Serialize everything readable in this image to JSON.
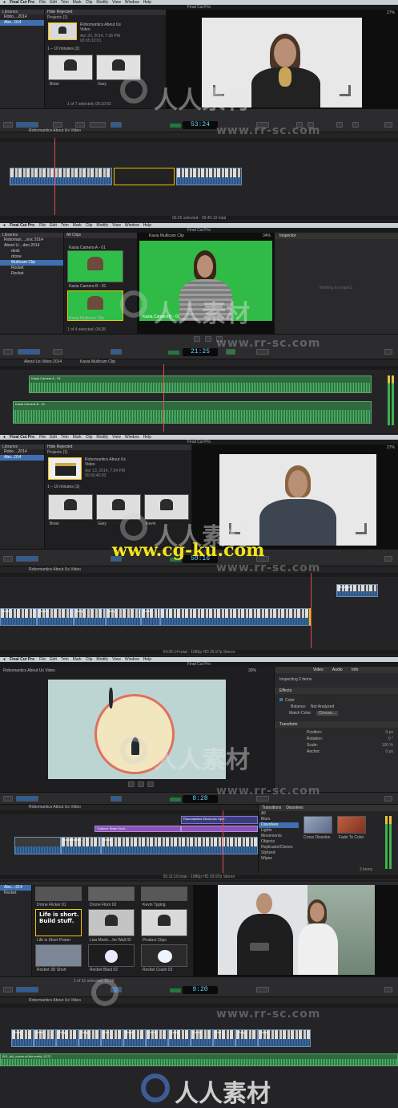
{
  "menu": {
    "app": "Final Cut Pro",
    "items": [
      "File",
      "Edit",
      "Trim",
      "Mark",
      "Clip",
      "Modify",
      "View",
      "Window",
      "Help"
    ]
  },
  "window_title": "Final Cut Pro",
  "panel1": {
    "libraries_label": "Libraries",
    "lib_items": [
      "Robo....2014",
      "Abo...014"
    ],
    "browser_filter": "Hide Rejected",
    "projects_section": "Projects",
    "projects_count": "(1)",
    "project_title": "Robomantics About Us Video",
    "project_date": "Apr 20, 2014, 7:36 PM",
    "project_duration": "00:05:10:01",
    "range_section": "1 – 10 minutes",
    "range_count": "(2)",
    "clip_names": [
      "Brian",
      "Gary"
    ],
    "selection_status": "1 of 7 selected, 05:10:01",
    "zoom": "27%",
    "timecode": "53:24",
    "timeline_title": "Robomantics About Us Video",
    "status": "00:25 selected - 05:40:10 total"
  },
  "panel2": {
    "libraries_label": "Libraries",
    "lib_items": [
      "Roboman....onic 2014",
      "About U....deo 2014",
      "desk",
      "drone",
      "Multicam Clip",
      "Rocket",
      "Rocket"
    ],
    "browser_filter": "All Clips",
    "clip_names": [
      "Kasia Camera A - 01",
      "Kasia Camera B - 01",
      "Kasia Multicam Clip"
    ],
    "viewer_title": "Kasia Multicam Clip",
    "zoom": "34%",
    "angle_label": "Kasia Camera B - 01",
    "inspector_title": "Inspector",
    "inspector_empty": "Nothing to Inspect",
    "selection_status": "1 of 4 selected, 09:28",
    "timecode": "21:25",
    "timeline_title": "About Us Video 2014",
    "timeline_sub": "Kasia Multicam Clip",
    "angles": [
      "Kasia Camera A - 01",
      "Kasia Camera B - 01"
    ]
  },
  "panel3": {
    "libraries_label": "Libraries",
    "lib_items": [
      "Robo....2014",
      "Abo...014"
    ],
    "browser_filter": "Hide Rejected",
    "projects_section": "Projects",
    "projects_count": "(1)",
    "project_title": "Robomantics About Us Video",
    "project_date": "Apr 13, 2014, 7:54 PM",
    "project_duration": "00:03:40:03",
    "range_section": "1 – 10 minutes",
    "range_count": "(3)",
    "clip_names": [
      "Brian",
      "Gary",
      "Kevin"
    ],
    "zoom": "27%",
    "timecode": "50:16",
    "timeline_title": "Robomantics About Us Video",
    "track_labels": [
      "Brian",
      "Brian",
      "Gary",
      "Gary",
      "Kevin",
      "Multicam"
    ],
    "status": "04:25:14 total - 1080p HD 29.97p Stereo"
  },
  "panel4": {
    "viewer_title": "Robomantics About Us Video",
    "zoom": "30%",
    "inspector_tabs": [
      "Video",
      "Audio",
      "Info"
    ],
    "inspecting": "Inspecting 2 items",
    "effects_label": "Effects",
    "color_label": "Color",
    "balance_label": "Balance:",
    "balance_value": "Not Analyzed",
    "match_label": "Match Color:",
    "match_value": "Choose...",
    "transform_label": "Transform",
    "position_label": "Position:",
    "position_value": "0 px",
    "rotation_label": "Rotation:",
    "rotation_value": "0 °",
    "scale_label": "Scale:",
    "scale_value": "100 %",
    "anchor_label": "Anchor:",
    "anchor_value": "0 px",
    "timecode": "8:28",
    "timeline_title": "Robomantics About Us Video",
    "clip_labels": [
      "Robomantics Electronic Spot",
      "Custom: Brian Kurd...",
      "Brian",
      "robomantics..."
    ],
    "fx_header": [
      "Transitions",
      "Dissolves"
    ],
    "fx_categories": [
      "All",
      "Blurs",
      "Dissolves",
      "Lights",
      "Movements",
      "Objects",
      "Replicator/Clones",
      "Stylized",
      "Wipes"
    ],
    "fx_items": [
      "Cross Dissolve",
      "Fade To Color"
    ],
    "fx_count": "2 items",
    "status": "05:11:19 total - 1080p HD 29.97p Stereo"
  },
  "panel5": {
    "lib_items": [
      "Abo....014",
      "Rocket"
    ],
    "clip_names": [
      "Drone Flicker 01",
      "Drone Floor 02",
      "Kevin Typing",
      "Life is Short Poster",
      "Lisa Monit....he Wall 02",
      "Product Clips",
      "Rocket 3D Short",
      "Rocket Blast 02",
      "Rocket Crash 03"
    ],
    "poster_text": "Life is short. Build stuff.",
    "selection_status": "1 of 31 selected, 10:28",
    "timecode": "9:20",
    "timeline_title": "Robomantics About Us Video",
    "track_labels": [
      "Brian",
      "Brian",
      "Gary",
      "Gary",
      "Lisa",
      "Brian",
      "Kevin",
      "Kevin",
      "Kevin",
      "Lisa",
      "Gary",
      "Brian"
    ],
    "music_label": "001_full_colors-of-the-world_0172"
  },
  "watermarks": {
    "cn": "人人素材",
    "url1": "www.rr-sc.com",
    "yellow": "www.cg-ku.com"
  }
}
